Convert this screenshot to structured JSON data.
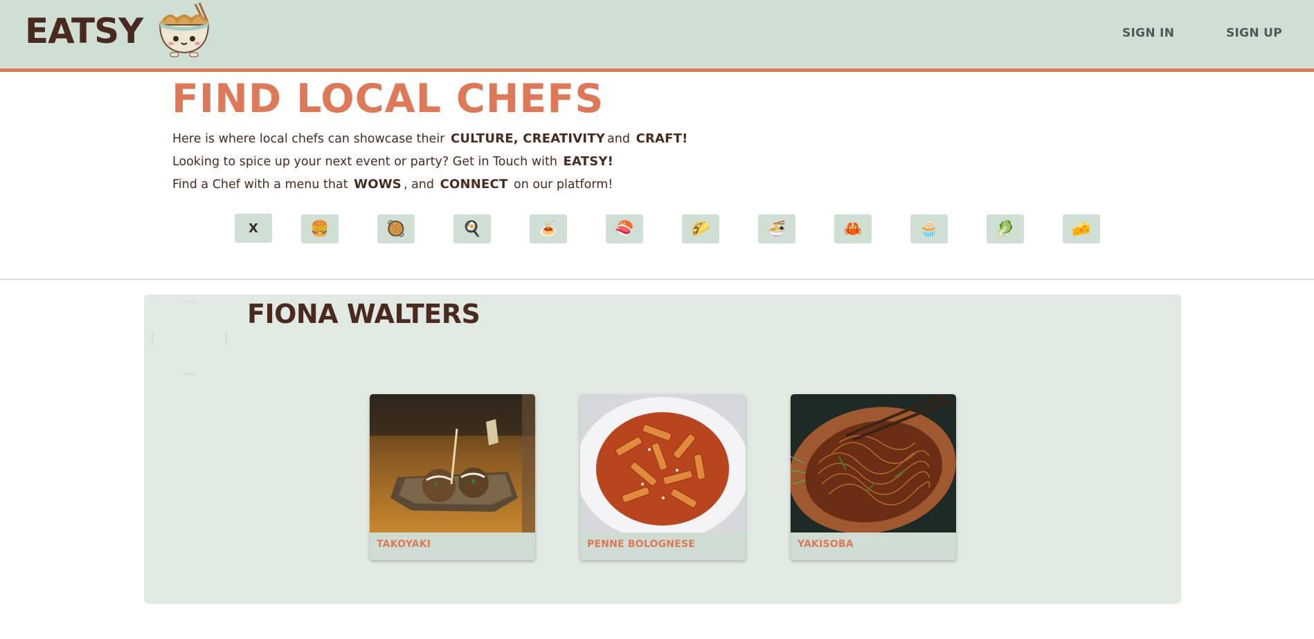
{
  "header": {
    "logo_text": "EATSY",
    "nav": {
      "sign_in": "SIGN IN",
      "sign_up": "SIGN UP"
    }
  },
  "hero": {
    "title": "FIND LOCAL CHEFS",
    "line1": {
      "pre": "Here is where local chefs can showcase their",
      "b1": "CULTURE, CREATIVITY",
      "mid": "and",
      "b2": "CRAFT!"
    },
    "line2": {
      "pre": "Looking to spice up your next event or party? Get in Touch with",
      "b1": "EATSY!"
    },
    "line3": {
      "pre": "Find a Chef with a menu that",
      "b1": "WOWS",
      "mid": ", and",
      "b2": "CONNECT",
      "post": "on our platform!"
    }
  },
  "filters": {
    "clear_label": "X",
    "categories": [
      {
        "icon": "burger-icon",
        "glyph": "🍔"
      },
      {
        "icon": "paella-icon",
        "glyph": "🥘"
      },
      {
        "icon": "fried-egg-icon",
        "glyph": "🍳"
      },
      {
        "icon": "pasta-icon",
        "glyph": "🍝"
      },
      {
        "icon": "sushi-icon",
        "glyph": "🍣"
      },
      {
        "icon": "taco-icon",
        "glyph": "🌮"
      },
      {
        "icon": "noodle-bowl-icon",
        "glyph": "🍜"
      },
      {
        "icon": "crab-icon",
        "glyph": "🦀"
      },
      {
        "icon": "cupcake-icon",
        "glyph": "🧁"
      },
      {
        "icon": "vegetable-icon",
        "glyph": "🥬"
      },
      {
        "icon": "cheese-icon",
        "glyph": "🧀"
      }
    ]
  },
  "chef": {
    "name": "FIONA WALTERS",
    "dishes": [
      {
        "name": "TAKOYAKI"
      },
      {
        "name": "PENNE BOLOGNESE"
      },
      {
        "name": "YAKISOBA"
      }
    ]
  },
  "colors": {
    "accent": "#df7856",
    "header_bg": "#cfdfd4",
    "panel_bg": "#e1e9e3",
    "text_dark": "#4a2a1f"
  }
}
